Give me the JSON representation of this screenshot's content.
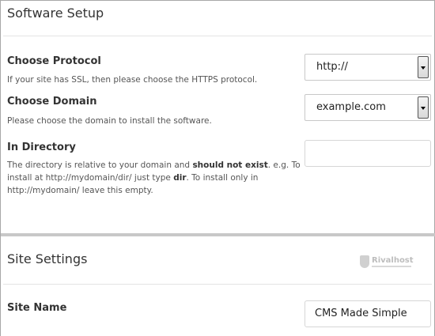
{
  "software_setup": {
    "title": "Software Setup",
    "protocol": {
      "label": "Choose Protocol",
      "description": "If your site has SSL, then please choose the HTTPS protocol.",
      "value": "http://"
    },
    "domain": {
      "label": "Choose Domain",
      "description": "Please choose the domain to install the software.",
      "value": "example.com"
    },
    "directory": {
      "label": "In Directory",
      "desc_1": "The directory is relative to your domain and ",
      "desc_bold_1": "should not exist",
      "desc_2": ". e.g. To install at http://mydomain/dir/ just type ",
      "desc_bold_2": "dir",
      "desc_3": ". To install only in http://mydomain/ leave this empty.",
      "value": ""
    }
  },
  "site_settings": {
    "title": "Site Settings",
    "logo_text": "Rivalhost",
    "site_name": {
      "label": "Site Name",
      "value": "CMS Made Simple"
    }
  }
}
